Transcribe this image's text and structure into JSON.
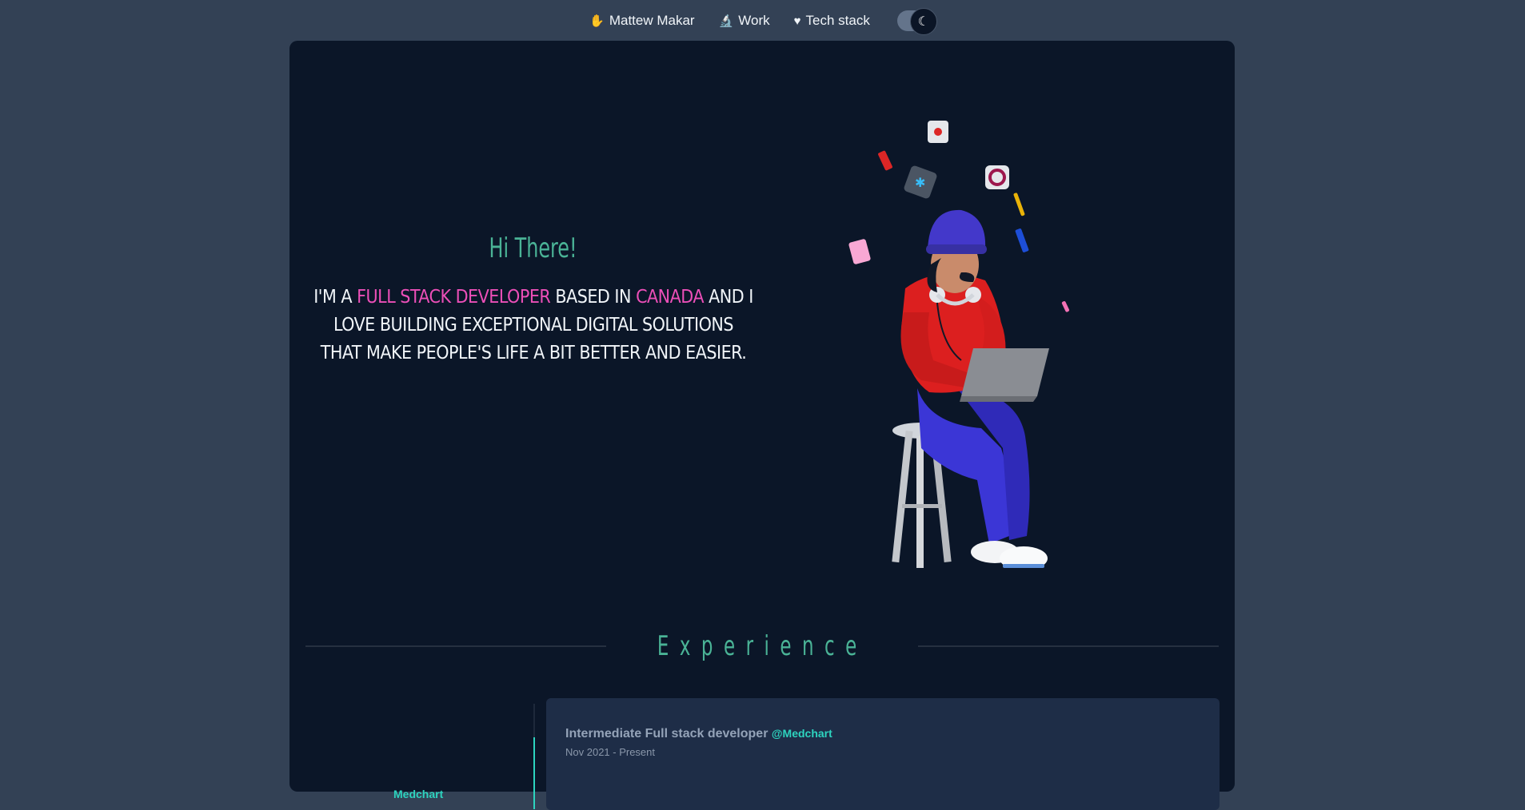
{
  "nav": {
    "items": [
      {
        "icon": "wave-hand-icon",
        "label": "Mattew Makar"
      },
      {
        "icon": "microscope-icon",
        "label": "Work"
      },
      {
        "icon": "heart-icon",
        "label": "Tech stack"
      }
    ],
    "theme_toggle": {
      "state": "dark",
      "icon": "moon-icon"
    }
  },
  "hero": {
    "title": "Hi There!",
    "intro_prefix": "I'm a",
    "role": "Full stack developer",
    "based_in": "based in",
    "location": "Canada",
    "intro_suffix": "and I love building exceptional digital solutions that make people's life a bit better and easier."
  },
  "experience": {
    "heading": "Experience",
    "companies": [
      "Medchart"
    ],
    "active_company": "Medchart",
    "role": "Intermediate Full stack developer",
    "company_tag": "@Medchart",
    "dates": "Nov 2021 - Present"
  },
  "colors": {
    "page_bg": "#334155",
    "card_bg": "#0b1628",
    "accent_green": "#4ab396",
    "accent_pink": "#ec4fb8",
    "accent_teal": "#2dd4bf"
  }
}
